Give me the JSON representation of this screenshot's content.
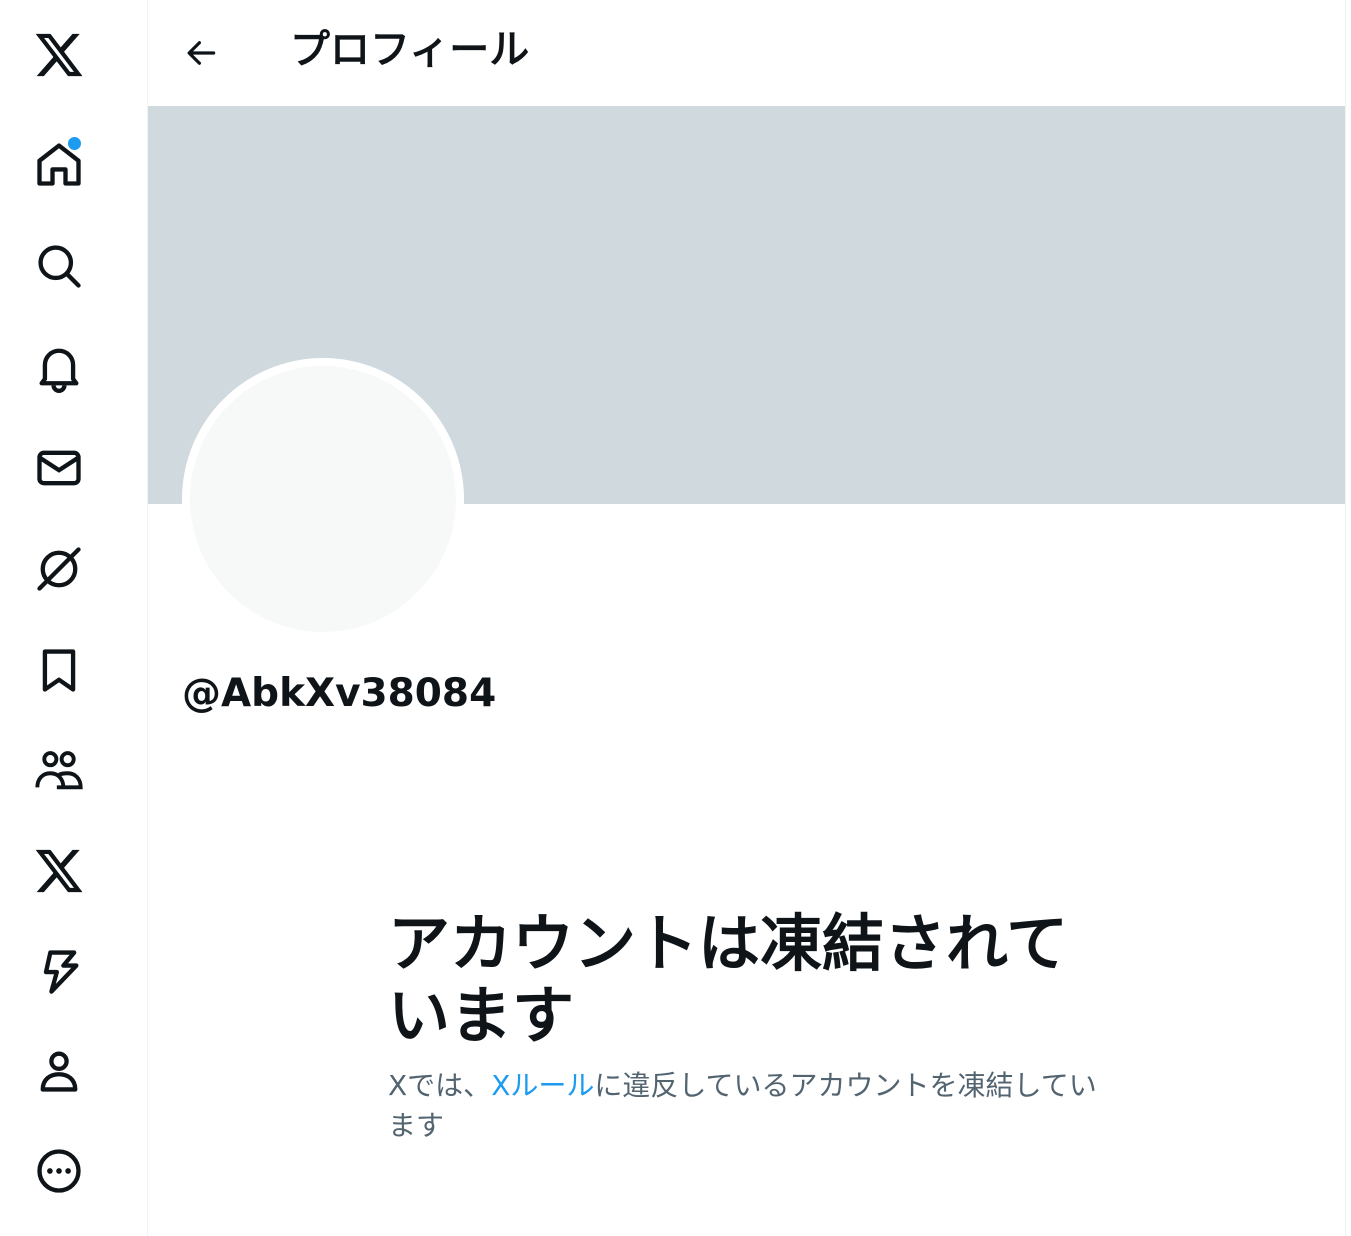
{
  "sidebar": {
    "items": [
      {
        "icon": "x-logo-icon",
        "label": "X"
      },
      {
        "icon": "home-icon",
        "label": "ホーム",
        "has_badge": true
      },
      {
        "icon": "search-icon",
        "label": "話題を検索"
      },
      {
        "icon": "bell-icon",
        "label": "通知"
      },
      {
        "icon": "mail-icon",
        "label": "メッセージ"
      },
      {
        "icon": "grok-icon",
        "label": "Grok"
      },
      {
        "icon": "bookmark-icon",
        "label": "ブックマーク"
      },
      {
        "icon": "communities-icon",
        "label": "コミュニティ"
      },
      {
        "icon": "premium-x-icon",
        "label": "プレミアム"
      },
      {
        "icon": "lightning-icon",
        "label": "認証済み組織"
      },
      {
        "icon": "profile-icon",
        "label": "プロフィール"
      },
      {
        "icon": "more-icon",
        "label": "もっと見る"
      }
    ],
    "badge_color": "#1d9bf0"
  },
  "header": {
    "title": "プロフィール",
    "back_icon": "arrow-left-icon"
  },
  "profile": {
    "handle": "@AbkXv38084",
    "banner_color": "#cfd9de",
    "avatar_color": "#f7f9f9"
  },
  "suspended": {
    "title": "アカウントは凍結されています",
    "desc_prefix": "Xでは、",
    "rules_link": "Xルール",
    "desc_suffix": "に違反しているアカウントを凍結しています",
    "link_color": "#1d9bf0"
  }
}
